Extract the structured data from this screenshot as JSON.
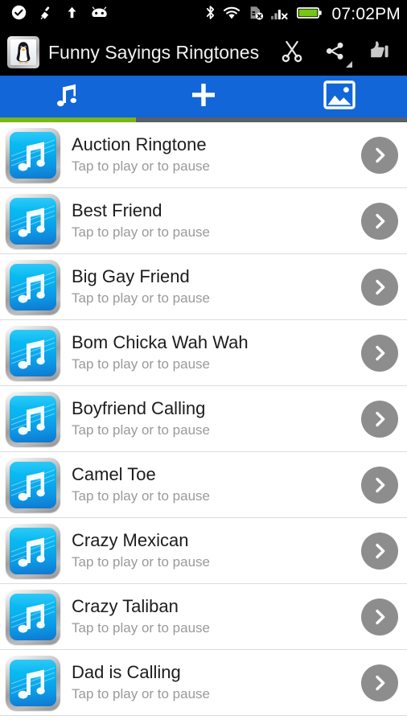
{
  "status_bar": {
    "left_icons": [
      {
        "name": "check-circle-icon"
      },
      {
        "name": "broom-icon"
      },
      {
        "name": "upload-arrow-icon"
      },
      {
        "name": "android-head-icon"
      }
    ],
    "right_icons": [
      {
        "name": "bluetooth-icon"
      },
      {
        "name": "wifi-icon"
      },
      {
        "name": "sim-card-missing-icon"
      },
      {
        "name": "signal-no-service-icon"
      },
      {
        "name": "battery-full-icon"
      }
    ],
    "clock": "07:02PM",
    "background": "#000000",
    "battery_color": "#76c615"
  },
  "action_bar": {
    "app_icon": "penguin-icon",
    "title": "Funny Sayings Ringtones",
    "buttons": [
      {
        "name": "cut-button",
        "icon": "scissors-icon"
      },
      {
        "name": "share-button",
        "icon": "share-icon"
      },
      {
        "name": "rate-button",
        "icon": "thumbs-up-icon"
      }
    ]
  },
  "tab_bar": {
    "background": "#1266d8",
    "active_underline_color": "#7cb518",
    "inactive_underline_color": "#5b5f66",
    "tabs": [
      {
        "name": "tab-ringtones",
        "icon": "music-note-icon",
        "active": true
      },
      {
        "name": "tab-add",
        "icon": "plus-icon",
        "active": false
      },
      {
        "name": "tab-wallpapers",
        "icon": "image-icon",
        "active": false
      }
    ]
  },
  "list": {
    "item_icon": "music-note-icon",
    "item_action_icon": "chevron-right-icon",
    "items": [
      {
        "title": "Auction Ringtone",
        "subtitle": "Tap to play or to pause"
      },
      {
        "title": "Best Friend",
        "subtitle": "Tap to play or to pause"
      },
      {
        "title": "Big Gay Friend",
        "subtitle": "Tap to play or to pause"
      },
      {
        "title": "Bom Chicka Wah Wah",
        "subtitle": "Tap to play or to pause"
      },
      {
        "title": "Boyfriend Calling",
        "subtitle": "Tap to play or to pause"
      },
      {
        "title": "Camel Toe",
        "subtitle": "Tap to play or to pause"
      },
      {
        "title": "Crazy Mexican",
        "subtitle": "Tap to play or to pause"
      },
      {
        "title": "Crazy Taliban",
        "subtitle": "Tap to play or to pause"
      },
      {
        "title": "Dad is Calling",
        "subtitle": "Tap to play or to pause"
      }
    ]
  }
}
